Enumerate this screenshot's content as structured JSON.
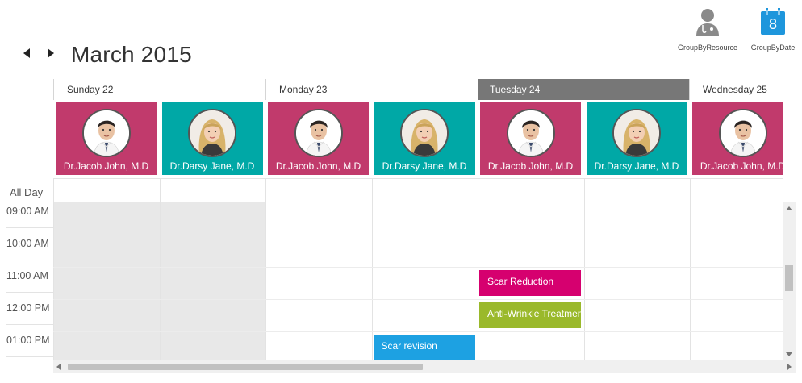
{
  "header": {
    "title": "March 2015",
    "prev_icon": "caret-left-icon",
    "next_icon": "caret-right-icon"
  },
  "view_buttons": [
    {
      "label": "GroupByResource",
      "icon": "doctor-icon"
    },
    {
      "label": "GroupByDate",
      "icon": "calendar-icon",
      "icon_text": "8",
      "color": "#1e96dc"
    }
  ],
  "dates": [
    {
      "label": "Sunday 22",
      "active": false
    },
    {
      "label": "Monday 23",
      "active": false
    },
    {
      "label": "Tuesday 24",
      "active": true
    },
    {
      "label": "Wednesday 25",
      "active": false
    }
  ],
  "resources": [
    {
      "name": "Dr.Jacob John, M.D",
      "color": "#c13a6c",
      "gender": "male"
    },
    {
      "name": "Dr.Darsy Jane, M.D",
      "color": "#00a8a6",
      "gender": "female"
    },
    {
      "name": "Dr.Jacob John, M.D",
      "color": "#c13a6c",
      "gender": "male"
    },
    {
      "name": "Dr.Darsy Jane, M.D",
      "color": "#00a8a6",
      "gender": "female"
    },
    {
      "name": "Dr.Jacob John, M.D",
      "color": "#c13a6c",
      "gender": "male"
    },
    {
      "name": "Dr.Darsy Jane, M.D",
      "color": "#00a8a6",
      "gender": "female"
    },
    {
      "name": "Dr.Jacob John, M.D",
      "color": "#c13a6c",
      "gender": "male"
    }
  ],
  "all_day_label": "All Day",
  "time_slots": [
    "09:00 AM",
    "10:00 AM",
    "11:00 AM",
    "12:00 PM",
    "01:00 PM"
  ],
  "appointments": [
    {
      "title": "Scar Reduction",
      "column": 4,
      "start_hour": 11.0,
      "end_hour": 11.9,
      "color": "#d6006f"
    },
    {
      "title": "Anti-Wrinkle Treatment",
      "column": 4,
      "start_hour": 12.0,
      "end_hour": 12.9,
      "color": "#9ab92b"
    },
    {
      "title": "Scar revision",
      "column": 3,
      "start_hour": 13.0,
      "end_hour": 14.0,
      "color": "#1da1e2"
    }
  ],
  "non_working_columns": [
    0,
    1
  ]
}
